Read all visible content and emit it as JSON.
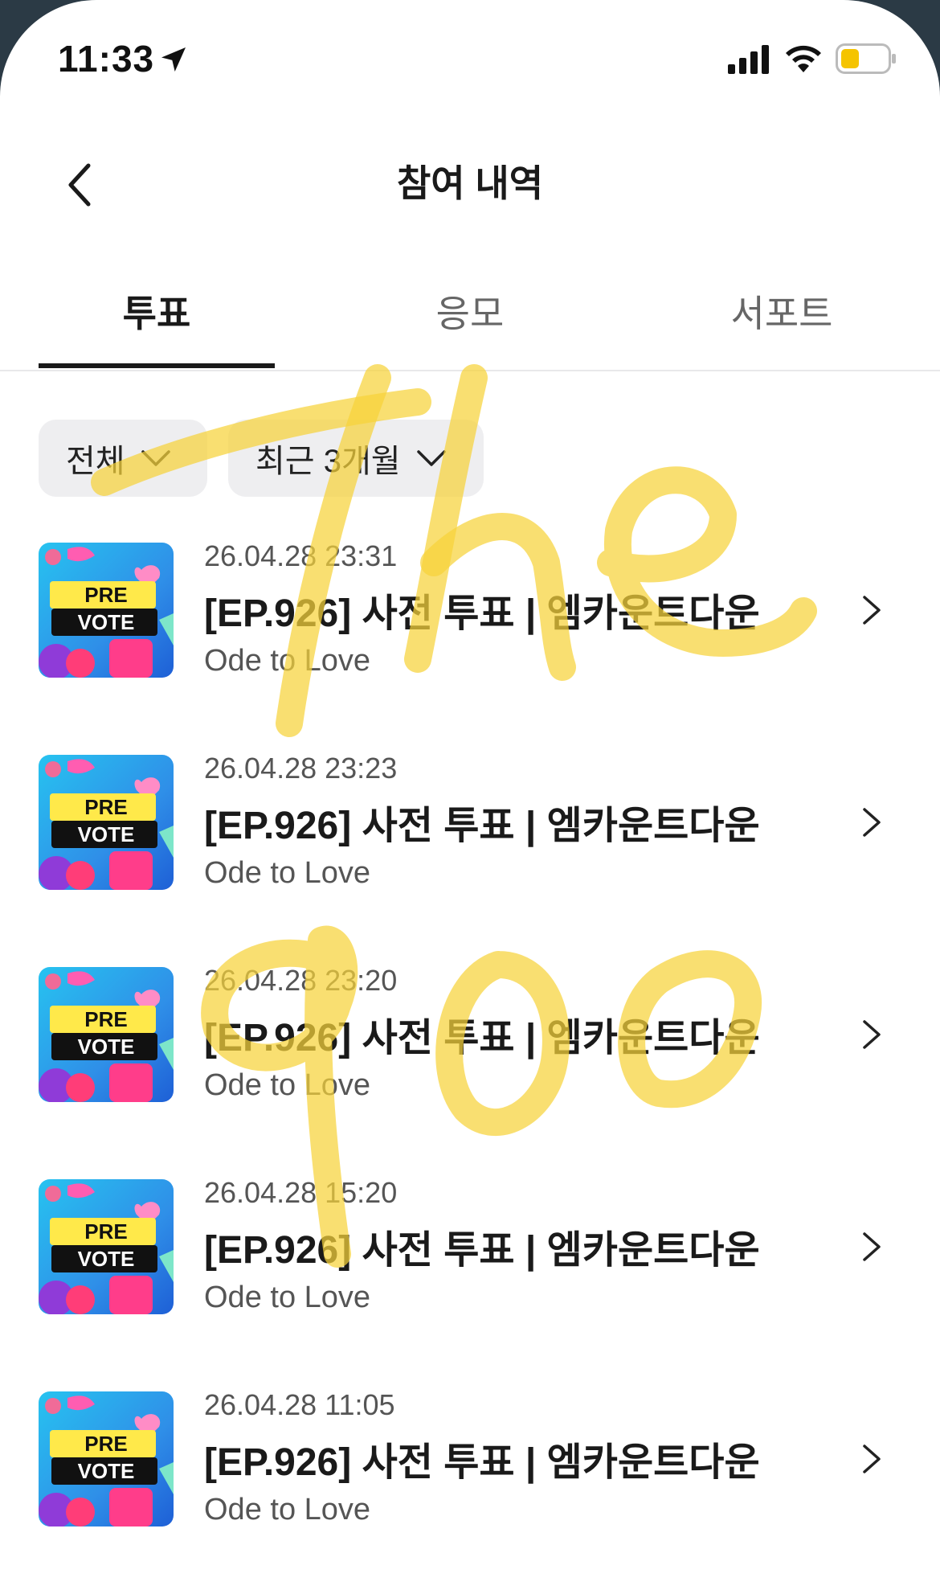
{
  "status_bar": {
    "time": "11:33",
    "icons": [
      "location-arrow-icon",
      "cellular-signal-icon",
      "wifi-icon",
      "battery-low-icon"
    ],
    "battery_color": "#f5c400"
  },
  "header": {
    "title": "참여 내역",
    "back_icon": "chevron-left-icon"
  },
  "tabs": [
    {
      "label": "투표",
      "active": true
    },
    {
      "label": "응모",
      "active": false
    },
    {
      "label": "서포트",
      "active": false
    }
  ],
  "filters": {
    "category": "전체",
    "period": "최근 3개월"
  },
  "items": [
    {
      "date": "26.04.28 23:31",
      "title": "[EP.926] 사전 투표 | 엠카운트다운",
      "subtitle": "Ode to Love",
      "thumb_top": "PRE",
      "thumb_bottom": "VOTE"
    },
    {
      "date": "26.04.28 23:23",
      "title": "[EP.926] 사전 투표 | 엠카운트다운",
      "subtitle": "Ode to Love",
      "thumb_top": "PRE",
      "thumb_bottom": "VOTE"
    },
    {
      "date": "26.04.28 23:20",
      "title": "[EP.926] 사전 투표 | 엠카운트다운",
      "subtitle": "Ode to Love",
      "thumb_top": "PRE",
      "thumb_bottom": "VOTE"
    },
    {
      "date": "26.04.28 15:20",
      "title": "[EP.926] 사전 투표 | 엠카운트다운",
      "subtitle": "Ode to Love",
      "thumb_top": "PRE",
      "thumb_bottom": "VOTE"
    },
    {
      "date": "26.04.28 11:05",
      "title": "[EP.926] 사전 투표 | 엠카운트다운",
      "subtitle": "Ode to Love",
      "thumb_top": "PRE",
      "thumb_bottom": "VOTE"
    }
  ],
  "colors": {
    "accent_text": "#1a1a1a",
    "muted_text": "#555555",
    "filter_bg": "#eeeef0",
    "watermark": "#f7d23a"
  }
}
